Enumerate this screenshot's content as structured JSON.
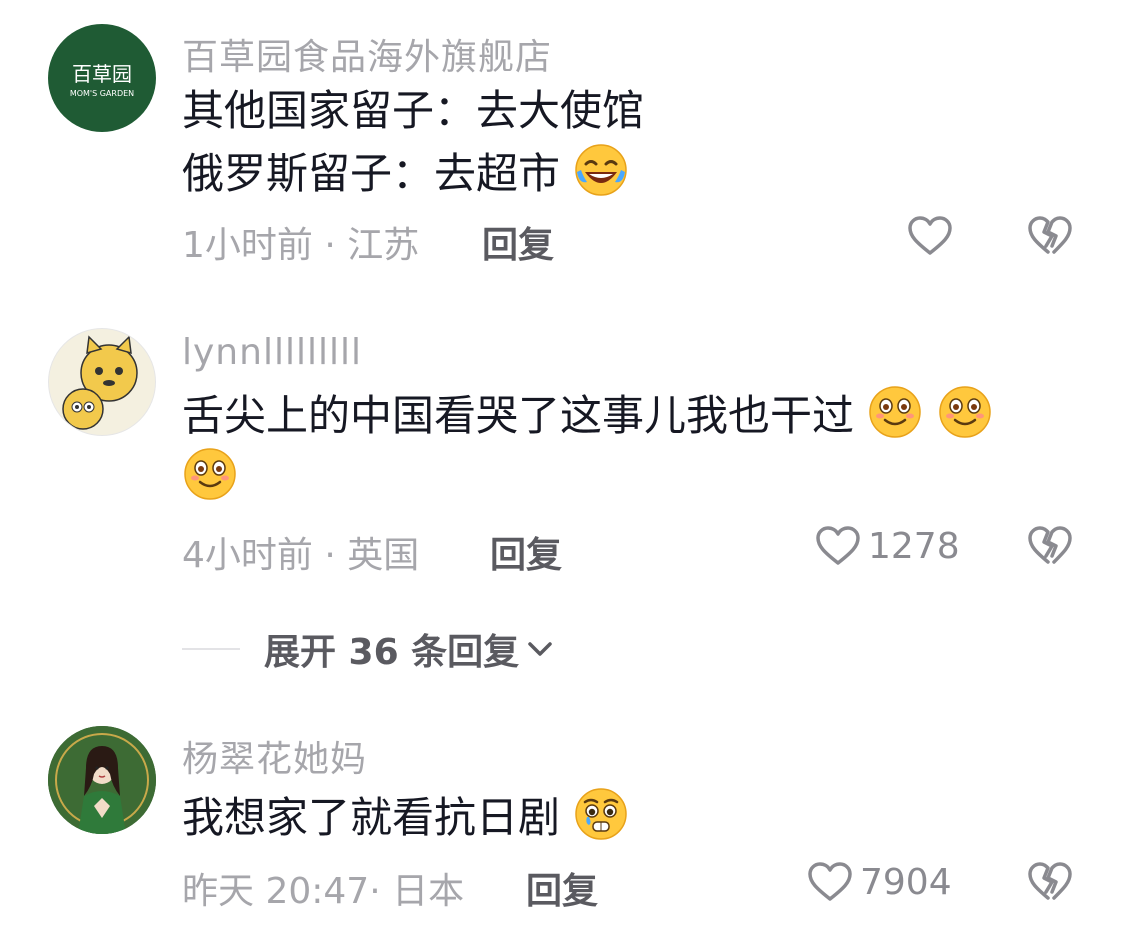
{
  "comments": [
    {
      "username": "百草园食品海外旗舰店",
      "avatar_text": "百草园",
      "avatar_subtext": "MOM'S GARDEN",
      "line1": "其他国家留子：去大使馆",
      "line2": "俄罗斯留子：去超市",
      "emoji": "laughing-tears-emoji",
      "time_location": "1小时前 · 江苏",
      "reply_label": "回复",
      "like_count": ""
    },
    {
      "username": "lynnlllllllll",
      "line1": "舌尖上的中国看哭了这事儿我也干过",
      "emoji": "blush-smile-emoji",
      "time_location": "4小时前 · 英国",
      "reply_label": "回复",
      "like_count": "1278"
    },
    {
      "username": "杨翠花她妈",
      "line1": "我想家了就看抗日剧",
      "emoji": "pleading-tears-emoji",
      "time_location": "昨天 20:47· 日本",
      "reply_label": "回复",
      "like_count": "7904"
    }
  ],
  "expand_replies": "展开 36 条回复",
  "colors": {
    "avatar_green": "#1f5b34",
    "text": "#161823",
    "muted": "#a6a6ab",
    "emoji_yellow": "#ffc83d"
  }
}
